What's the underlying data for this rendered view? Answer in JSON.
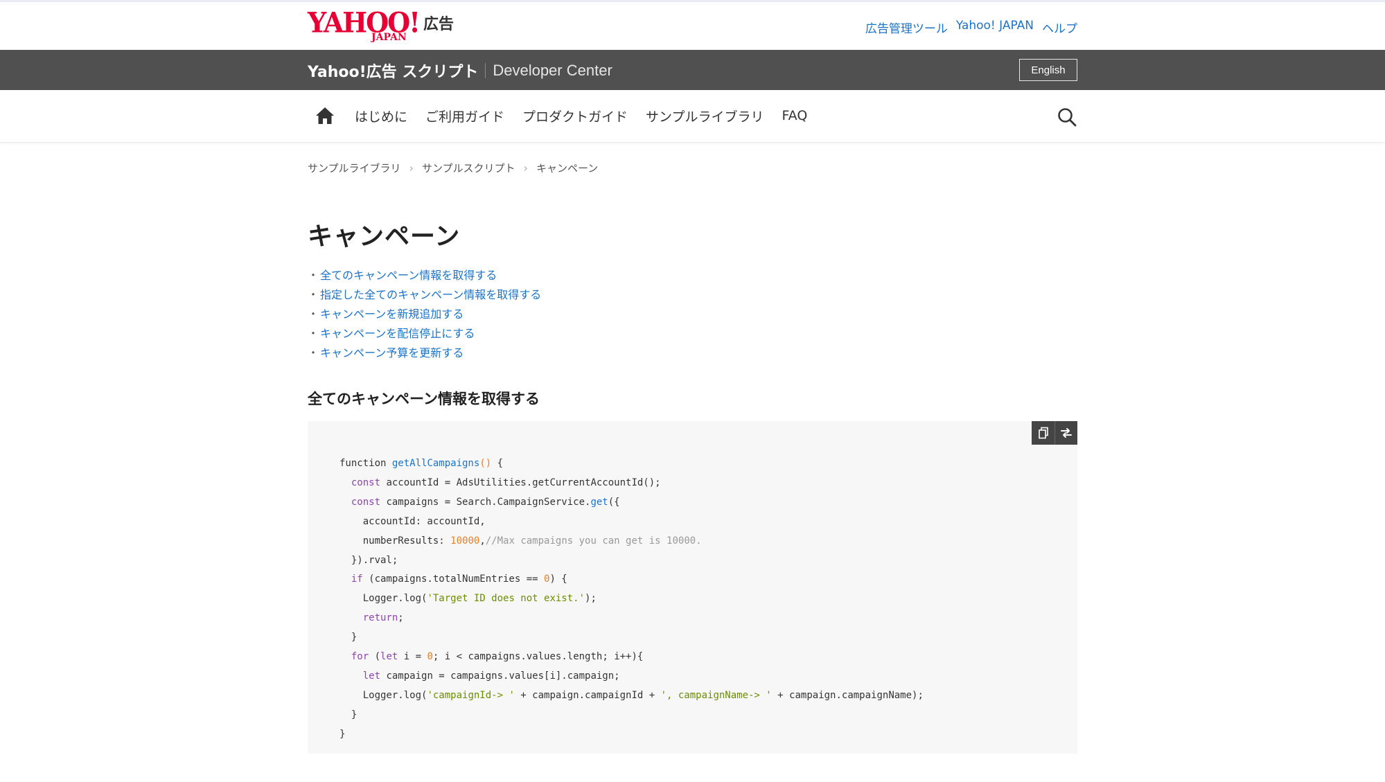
{
  "header": {
    "logo_text": "YAHOO!",
    "logo_sub": "JAPAN",
    "logo_suffix": "広告",
    "links": [
      "広告管理ツール",
      "Yahoo! JAPAN",
      "ヘルプ"
    ]
  },
  "band": {
    "title": "Yahoo!広告 スクリプト",
    "subtitle": "Developer Center",
    "language_button": "English"
  },
  "nav": {
    "items": [
      "はじめに",
      "ご利用ガイド",
      "プロダクトガイド",
      "サンプルライブラリ",
      "FAQ"
    ]
  },
  "breadcrumb": [
    "サンプルライブラリ",
    "サンプルスクリプト",
    "キャンペーン"
  ],
  "page": {
    "title": "キャンペーン",
    "toc": [
      "全てのキャンペーン情報を取得する",
      "指定した全てのキャンペーン情報を取得する",
      "キャンペーンを新規追加する",
      "キャンペーンを配信停止にする",
      "キャンペーン予算を更新する"
    ],
    "section_title": "全てのキャンペーン情報を取得する"
  },
  "code": {
    "fn_name": "getAllCampaigns",
    "comment": "//Max campaigns you can get is 10000.",
    "max_results": "10000",
    "msg_not_exist": "'Target ID does not exist.'",
    "label_id": "'campaignId-> '",
    "label_name": "', campaignName-> '"
  },
  "colors": {
    "brand_red": "#e60033",
    "link_blue": "#1a73c8",
    "band_gray": "#505050"
  }
}
